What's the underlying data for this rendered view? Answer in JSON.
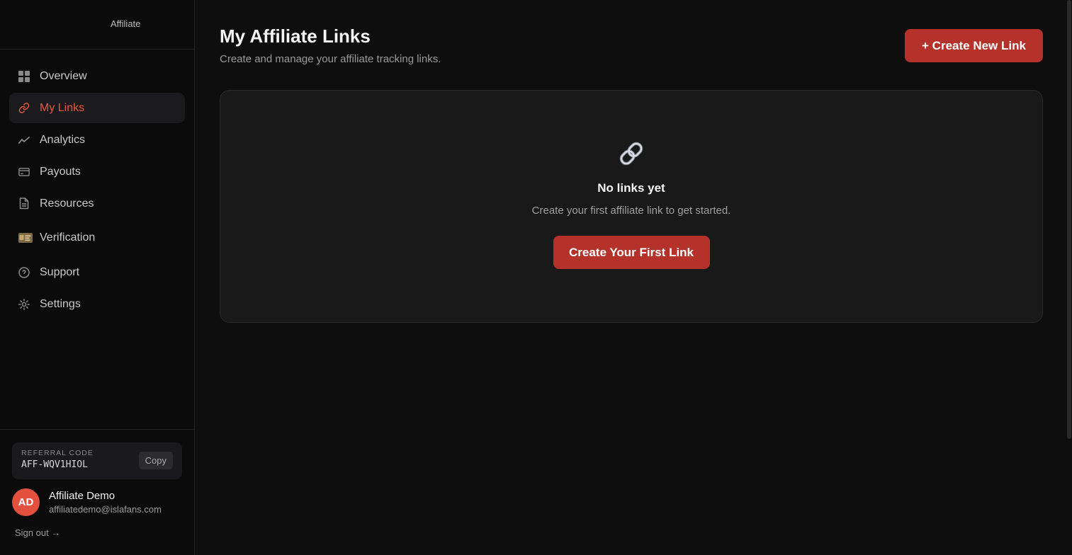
{
  "brand": {
    "label": "Affiliate"
  },
  "nav": [
    {
      "label": "Overview",
      "icon": "grid-icon",
      "active": false
    },
    {
      "label": "My Links",
      "icon": "link-icon",
      "active": true
    },
    {
      "label": "Analytics",
      "icon": "trend-icon",
      "active": false
    },
    {
      "label": "Payouts",
      "icon": "card-icon",
      "active": false
    },
    {
      "label": "Resources",
      "icon": "document-icon",
      "active": false
    },
    {
      "label": "Verification",
      "icon": "id-card-icon",
      "active": false
    },
    {
      "label": "Support",
      "icon": "help-circle-icon",
      "active": false
    },
    {
      "label": "Settings",
      "icon": "gear-icon",
      "active": false
    }
  ],
  "referral": {
    "title": "REFERRAL CODE",
    "code": "AFF-WQV1HIOL",
    "copy_label": "Copy"
  },
  "user": {
    "initials": "AD",
    "name": "Affiliate Demo",
    "email": "affiliatedemo@islafans.com"
  },
  "signout_label": "Sign out →",
  "page": {
    "title": "My Affiliate Links",
    "subtitle": "Create and manage your affiliate tracking links.",
    "create_button": "+ Create New Link"
  },
  "empty_state": {
    "icon": "chain-link-icon",
    "title": "No links yet",
    "subtitle": "Create your first affiliate link to get started.",
    "button": "Create Your First Link"
  },
  "colors": {
    "accent": "#e8553f",
    "button": "#b4322a",
    "background": "#0e0e0f",
    "card": "#19191a"
  }
}
